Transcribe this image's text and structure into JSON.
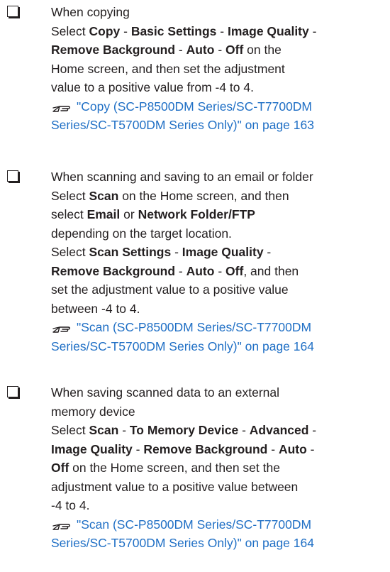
{
  "items": [
    {
      "lines": [
        [
          {
            "t": "When copying"
          }
        ],
        [
          {
            "t": "Select "
          },
          {
            "t": "Copy",
            "b": true
          },
          {
            "t": " - "
          },
          {
            "t": "Basic Settings",
            "b": true
          },
          {
            "t": " - "
          },
          {
            "t": "Image Quality",
            "b": true
          },
          {
            "t": " -"
          }
        ],
        [
          {
            "t": "Remove Background",
            "b": true
          },
          {
            "t": " - "
          },
          {
            "t": "Auto",
            "b": true
          },
          {
            "t": " - "
          },
          {
            "t": "Off",
            "b": true
          },
          {
            "t": " on the"
          }
        ],
        [
          {
            "t": "Home screen, and then set the adjustment"
          }
        ],
        [
          {
            "t": "value to a positive value from -4 to 4."
          }
        ]
      ],
      "link_lines": [
        "\"Copy (SC-P8500DM Series/SC-T7700DM",
        "Series/SC-T5700DM Series Only)\" on page 163"
      ]
    },
    {
      "lines": [
        [
          {
            "t": "When scanning and saving to an email or folder"
          }
        ],
        [
          {
            "t": "Select "
          },
          {
            "t": "Scan",
            "b": true
          },
          {
            "t": " on the Home screen, and then"
          }
        ],
        [
          {
            "t": "select "
          },
          {
            "t": "Email",
            "b": true
          },
          {
            "t": " or "
          },
          {
            "t": "Network Folder/FTP",
            "b": true
          }
        ],
        [
          {
            "t": "depending on the target location."
          }
        ],
        [
          {
            "t": "Select "
          },
          {
            "t": "Scan Settings",
            "b": true
          },
          {
            "t": " - "
          },
          {
            "t": "Image Quality",
            "b": true
          },
          {
            "t": " -"
          }
        ],
        [
          {
            "t": "Remove Background",
            "b": true
          },
          {
            "t": " - "
          },
          {
            "t": "Auto",
            "b": true
          },
          {
            "t": " - "
          },
          {
            "t": "Off",
            "b": true
          },
          {
            "t": ", and then"
          }
        ],
        [
          {
            "t": "set the adjustment value to a positive value"
          }
        ],
        [
          {
            "t": "between -4 to 4."
          }
        ]
      ],
      "link_lines": [
        "\"Scan (SC-P8500DM Series/SC-T7700DM",
        "Series/SC-T5700DM Series Only)\" on page 164"
      ]
    },
    {
      "lines": [
        [
          {
            "t": "When saving scanned data to an external"
          }
        ],
        [
          {
            "t": "memory device"
          }
        ],
        [
          {
            "t": "Select "
          },
          {
            "t": "Scan",
            "b": true
          },
          {
            "t": " - "
          },
          {
            "t": "To Memory Device",
            "b": true
          },
          {
            "t": " - "
          },
          {
            "t": "Advanced",
            "b": true
          },
          {
            "t": " -"
          }
        ],
        [
          {
            "t": "Image Quality",
            "b": true
          },
          {
            "t": " - "
          },
          {
            "t": "Remove Background",
            "b": true
          },
          {
            "t": " - "
          },
          {
            "t": "Auto",
            "b": true
          },
          {
            "t": " -"
          }
        ],
        [
          {
            "t": "Off",
            "b": true
          },
          {
            "t": " on the Home screen, and then set the"
          }
        ],
        [
          {
            "t": "adjustment value to a positive value between"
          }
        ],
        [
          {
            "t": "-4 to 4."
          }
        ]
      ],
      "link_lines": [
        "\"Scan (SC-P8500DM Series/SC-T7700DM",
        "Series/SC-T5700DM Series Only)\" on page 164"
      ]
    }
  ],
  "colors": {
    "text": "#231f20",
    "link": "#1f6fc5"
  },
  "icons": {
    "checkbox": "checkbox-icon",
    "reference": "pointing-hand-icon"
  }
}
